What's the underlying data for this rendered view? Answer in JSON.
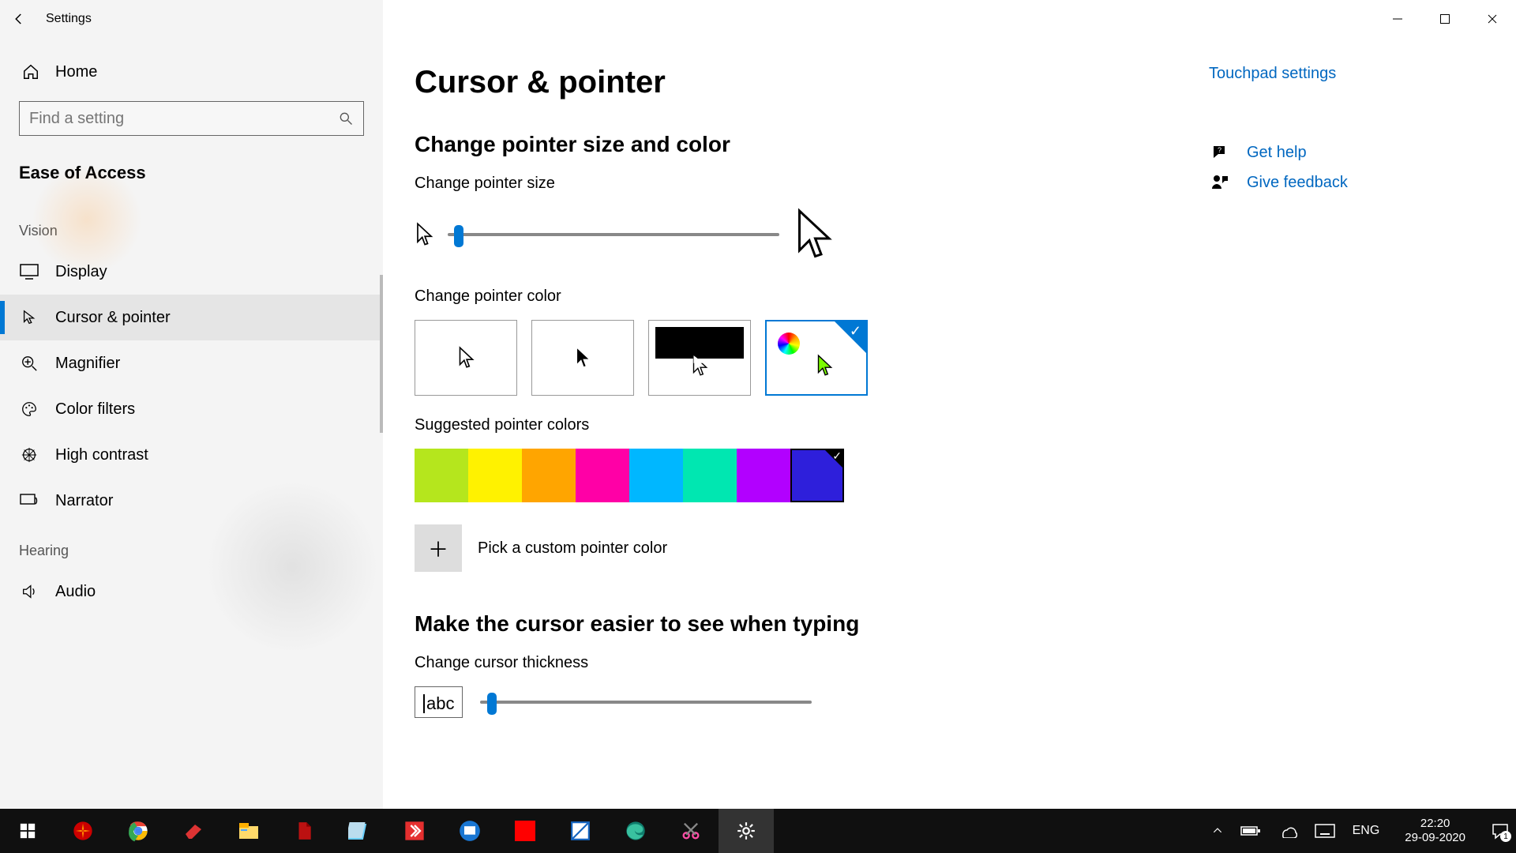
{
  "window": {
    "app_title": "Settings",
    "minimize": "—",
    "maximize": "▢",
    "close": "✕"
  },
  "sidebar": {
    "home": "Home",
    "search_placeholder": "Find a setting",
    "section": "Ease of Access",
    "groups": {
      "vision_label": "Vision",
      "hearing_label": "Hearing"
    },
    "items": {
      "display": "Display",
      "cursor": "Cursor & pointer",
      "magnifier": "Magnifier",
      "color_filters": "Color filters",
      "high_contrast": "High contrast",
      "narrator": "Narrator",
      "audio": "Audio"
    },
    "selected": "cursor"
  },
  "page": {
    "title": "Cursor & pointer",
    "h_size_color": "Change pointer size and color",
    "lbl_pointer_size": "Change pointer size",
    "pointer_size_value_pct": 2,
    "lbl_pointer_color": "Change pointer color",
    "color_tiles": {
      "white": "white-cursor",
      "black": "black-cursor",
      "inverted": "inverted-cursor",
      "custom": "custom-color-cursor",
      "selected": "custom"
    },
    "lbl_suggested": "Suggested pointer colors",
    "swatches": [
      {
        "name": "lime",
        "hex": "#B5E61D"
      },
      {
        "name": "yellow",
        "hex": "#FFF200"
      },
      {
        "name": "orange",
        "hex": "#FFA500"
      },
      {
        "name": "magenta",
        "hex": "#FF00A6"
      },
      {
        "name": "sky",
        "hex": "#00B7FF"
      },
      {
        "name": "teal",
        "hex": "#00E7B1"
      },
      {
        "name": "purple",
        "hex": "#B200FF"
      },
      {
        "name": "blue",
        "hex": "#2E1FDB"
      }
    ],
    "swatch_selected_index": 7,
    "custom_color_label": "Pick a custom pointer color",
    "h_cursor_typing": "Make the cursor easier to see when typing",
    "lbl_thickness": "Change cursor thickness",
    "thickness_preview": "abc",
    "thickness_value_pct": 2
  },
  "right": {
    "touchpad": "Touchpad settings",
    "get_help": "Get help",
    "feedback": "Give feedback"
  },
  "taskbar": {
    "lang": "ENG",
    "time": "22:20",
    "date": "29-09-2020",
    "notification_count": "1"
  }
}
